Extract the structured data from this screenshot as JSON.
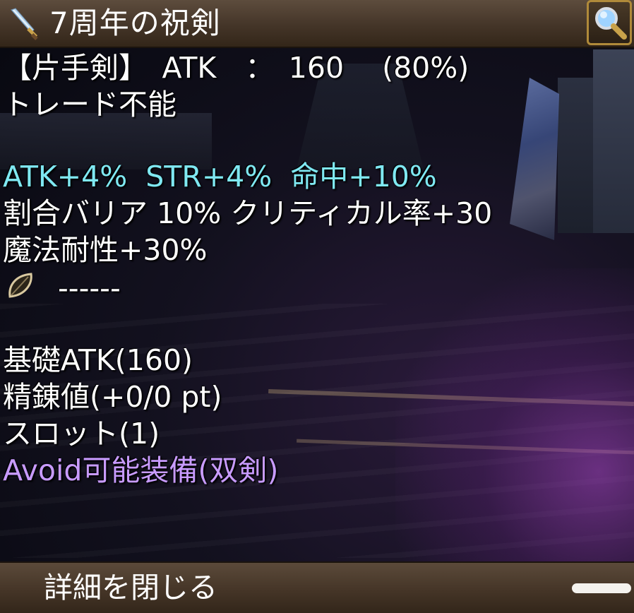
{
  "item": {
    "name": "7周年の祝剣"
  },
  "lines": {
    "type_attack": "【片手剣】　ATK　：　160　 (80%)",
    "trade": "トレード不能",
    "bonus_stats": "ATK+4%  STR+4%  命中+10%",
    "barrier_crit": "割合バリア 10% クリティカル率+30",
    "magic_res": "魔法耐性+30%",
    "slot_placeholder": "------",
    "base_atk": "基礎ATK(160)",
    "refine": "精錬値(+0/0 pt)",
    "slots": "スロット(1)",
    "avoid": "Avoid可能装備(双剣)"
  },
  "footer": {
    "close_label": "詳細を閉じる"
  },
  "colors": {
    "bonus_text": "#7fe8f2",
    "avoid_text": "#c89bff",
    "panel_bar": "#443528",
    "search_frame": "#b08a3a"
  },
  "icons": {
    "item_icon": "sword-icon",
    "search": "magnifier-icon",
    "slot": "leaf-icon"
  }
}
